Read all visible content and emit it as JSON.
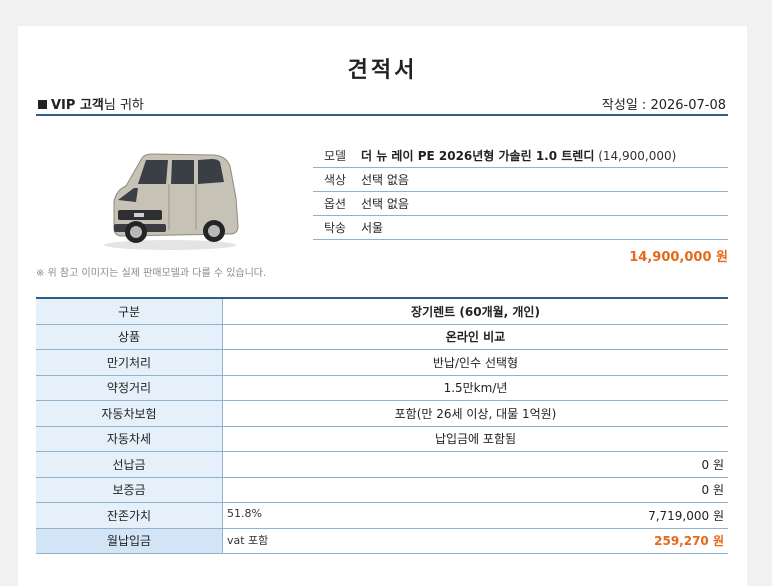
{
  "doc": {
    "title": "견적서"
  },
  "header": {
    "recipient_bold": "VIP 고객",
    "recipient_rest": "님 귀하",
    "date_text": "작성일 : 2026-07-08"
  },
  "vehicle": {
    "image_icon": "car-icon",
    "disclaimer": "※ 위 참고 이미지는 실제 판매모델과 다를 수 있습니다.",
    "model_label": "모델",
    "model_name": "더 뉴 레이 PE 2026년형 가솔린 1.0 트렌디",
    "model_price": "(14,900,000)",
    "color_label": "색상",
    "color_value": "선택 없음",
    "option_label": "옵션",
    "option_value": "선택 없음",
    "delivery_label": "탁송",
    "delivery_value": "서울",
    "total": "14,900,000 원",
    "car_color": "#c6c2b6"
  },
  "quote": {
    "rows": [
      {
        "label": "구분",
        "value": "장기렌트 (60개월, 개인)"
      },
      {
        "label": "상품",
        "value": "온라인 비교"
      },
      {
        "label": "만기처리",
        "value": "반납/인수 선택형"
      },
      {
        "label": "약정거리",
        "value": "1.5만km/년"
      },
      {
        "label": "자동차보험",
        "value": "포함(만 26세 이상, 대물 1억원)"
      },
      {
        "label": "자동차세",
        "value": "납입금에 포함됨"
      },
      {
        "label": "선납금",
        "value": "0 원"
      },
      {
        "label": "보증금",
        "value": "0 원"
      },
      {
        "label": "잔존가치",
        "left": "51.8%",
        "value": "7,719,000 원"
      },
      {
        "label": "월납입금",
        "left": "vat 포함",
        "value": "259,270 원"
      }
    ]
  },
  "colors": {
    "accent": "#2f5f87",
    "highlight": "#e8681a",
    "label_bg": "#e6f0fb"
  }
}
